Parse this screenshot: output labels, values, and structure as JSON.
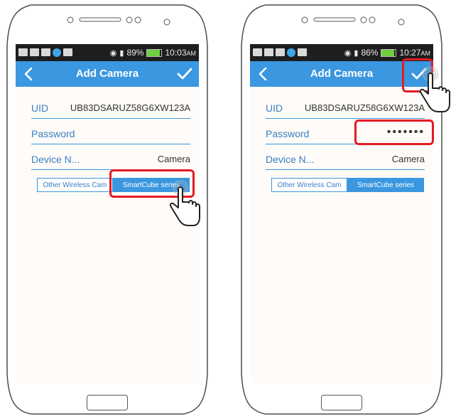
{
  "screens": [
    {
      "status": {
        "battery": "89%",
        "time": "10:03",
        "ampm": "AM",
        "battery_level": 0.89
      },
      "header": {
        "title": "Add Camera"
      },
      "fields": {
        "uid_label": "UID",
        "uid_value": "UB83DSARUZ58G6XW123A",
        "password_label": "Password",
        "password_value": "",
        "device_label": "Device N...",
        "device_value": "Camera"
      },
      "segments": [
        "Other Wireless Cam",
        "SmartCube series"
      ],
      "selected_segment": "SmartCube series"
    },
    {
      "status": {
        "battery": "86%",
        "time": "10:27",
        "ampm": "AM",
        "battery_level": 0.86
      },
      "header": {
        "title": "Add Camera"
      },
      "fields": {
        "uid_label": "UID",
        "uid_value": "UB83DSARUZ58G6XW123A",
        "password_label": "Password",
        "password_value": "•••••••",
        "device_label": "Device N...",
        "device_value": "Camera"
      },
      "segments": [
        "Other Wireless Cam",
        "SmartCube series"
      ],
      "selected_segment": "SmartCube series"
    }
  ],
  "colors": {
    "accent": "#3a97e0",
    "highlight": "#e31b23",
    "status_bar": "#1e1e1e"
  }
}
